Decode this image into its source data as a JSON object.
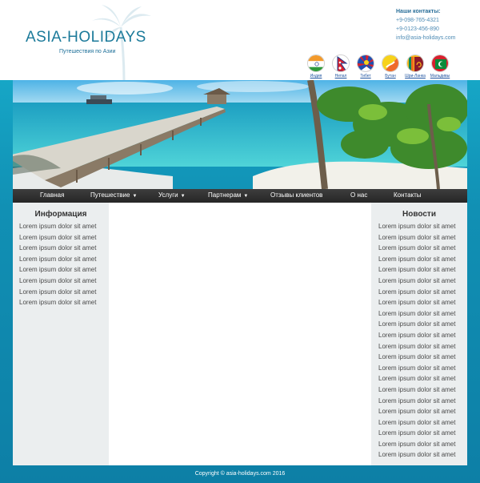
{
  "header": {
    "logo": "ASIA-HOLIDAYS",
    "tagline": "Путешествия по Азии",
    "contacts": {
      "title": "Наши контакты:",
      "phone1": "+9-098-765-4321",
      "phone2": "+9-0123-456-890",
      "email": "info@asia-holidays.com"
    },
    "flags": [
      {
        "label": "Индия",
        "icon": "india-flag-icon"
      },
      {
        "label": "Непал",
        "icon": "nepal-flag-icon"
      },
      {
        "label": "Тибет",
        "icon": "tibet-flag-icon"
      },
      {
        "label": "Бутан",
        "icon": "bhutan-flag-icon"
      },
      {
        "label": "Шри-Ланка",
        "icon": "sri-lanka-flag-icon"
      },
      {
        "label": "Мальдивы",
        "icon": "maldives-flag-icon"
      }
    ]
  },
  "nav": {
    "items": [
      {
        "label": "Главная"
      },
      {
        "label": "Путешествие",
        "arrow": "▼"
      },
      {
        "label": "Услуги",
        "arrow": "▼"
      },
      {
        "label": "Партнерам",
        "arrow": "▼"
      },
      {
        "label": "Отзывы клиентов"
      },
      {
        "label": "О нас"
      },
      {
        "label": "Контакты"
      }
    ]
  },
  "left_column": {
    "title": "Информация",
    "items": [
      "Lorem ipsum dolor sit amet",
      "Lorem ipsum dolor sit amet",
      "Lorem ipsum dolor sit amet",
      "Lorem ipsum dolor sit amet",
      "Lorem ipsum dolor sit amet",
      "Lorem ipsum dolor sit amet",
      "Lorem ipsum dolor sit amet",
      "Lorem ipsum dolor sit amet"
    ]
  },
  "right_column": {
    "title": "Новости",
    "items": [
      "Lorem ipsum dolor sit amet",
      "Lorem ipsum dolor sit amet",
      "Lorem ipsum dolor sit amet",
      "Lorem ipsum dolor sit amet",
      "Lorem ipsum dolor sit amet",
      "Lorem ipsum dolor sit amet",
      "Lorem ipsum dolor sit amet",
      "Lorem ipsum dolor sit amet",
      "Lorem ipsum dolor sit amet",
      "Lorem ipsum dolor sit amet",
      "Lorem ipsum dolor sit amet",
      "Lorem ipsum dolor sit amet",
      "Lorem ipsum dolor sit amet",
      "Lorem ipsum dolor sit amet",
      "Lorem ipsum dolor sit amet",
      "Lorem ipsum dolor sit amet",
      "Lorem ipsum dolor sit amet",
      "Lorem ipsum dolor sit amet",
      "Lorem ipsum dolor sit amet",
      "Lorem ipsum dolor sit amet",
      "Lorem ipsum dolor sit amet",
      "Lorem ipsum dolor sit amet"
    ]
  },
  "footer": {
    "text": "Copyright © asia-holidays.com 2016"
  },
  "colors": {
    "brand": "#1b7a9a",
    "nav_bg": "#2f2f2f",
    "sidebar_bg": "#ebeeef",
    "page_bg": "#1190b4"
  }
}
